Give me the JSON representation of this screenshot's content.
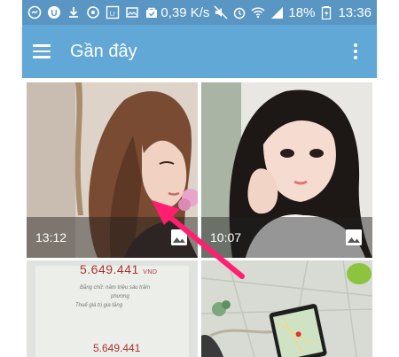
{
  "status_bar": {
    "speed": "0,39 K/s",
    "battery": "18%",
    "time": "13:36"
  },
  "app_bar": {
    "title": "Gần đây"
  },
  "photos": [
    {
      "time": "13:12"
    },
    {
      "time": "10:07"
    }
  ],
  "receipt": {
    "amount": "5.649.441",
    "currency": "VND",
    "line1": "Bằng chữ: năm triệu sáu trăm",
    "line2": "phương",
    "line3": "Thuế giá trị gia tăng",
    "line4": "5.649.441"
  },
  "colors": {
    "status_bar": "#5a96c4",
    "app_bar": "#62a8d6",
    "arrow": "#ff1f6e"
  }
}
